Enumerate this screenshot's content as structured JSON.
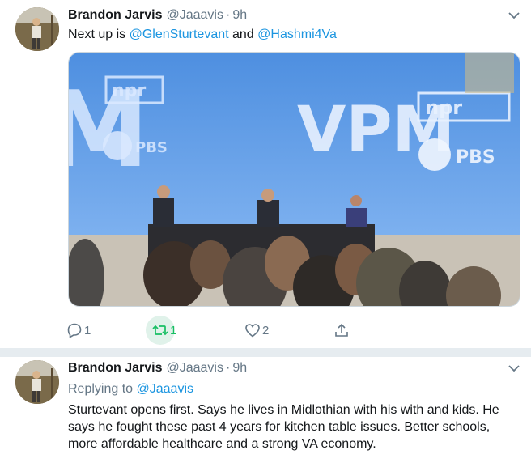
{
  "tweets": [
    {
      "author": {
        "name": "Brandon Jarvis",
        "handle": "@Jaaavis",
        "dot": "·",
        "time": "9h"
      },
      "text": {
        "prefix": "Next up is ",
        "mention1": "@GlenSturtevant",
        "middle": " and ",
        "mention2": "@Hashmi4Va"
      },
      "media": {
        "signs": {
          "station": "VPM",
          "network1": "npr",
          "network2": "PBS"
        }
      },
      "actions": {
        "reply": {
          "icon": "reply-icon",
          "count": "1"
        },
        "retweet": {
          "icon": "retweet-icon",
          "count": "1"
        },
        "like": {
          "icon": "heart-icon",
          "count": "2"
        },
        "share": {
          "icon": "share-icon"
        }
      }
    },
    {
      "author": {
        "name": "Brandon Jarvis",
        "handle": "@Jaaavis",
        "dot": "·",
        "time": "9h"
      },
      "replying": {
        "prefix": "Replying to ",
        "mention": "@Jaaavis"
      },
      "text": "Sturtevant opens first. Says he lives in Midlothian with his with and kids. He says he fought these past 4 years for kitchen table issues. Better schools, more affordable healthcare and a strong VA economy."
    }
  ],
  "colors": {
    "link": "#1b95e0",
    "muted": "#657786",
    "retweet": "#17bf63",
    "separator": "#e6ecf0"
  }
}
